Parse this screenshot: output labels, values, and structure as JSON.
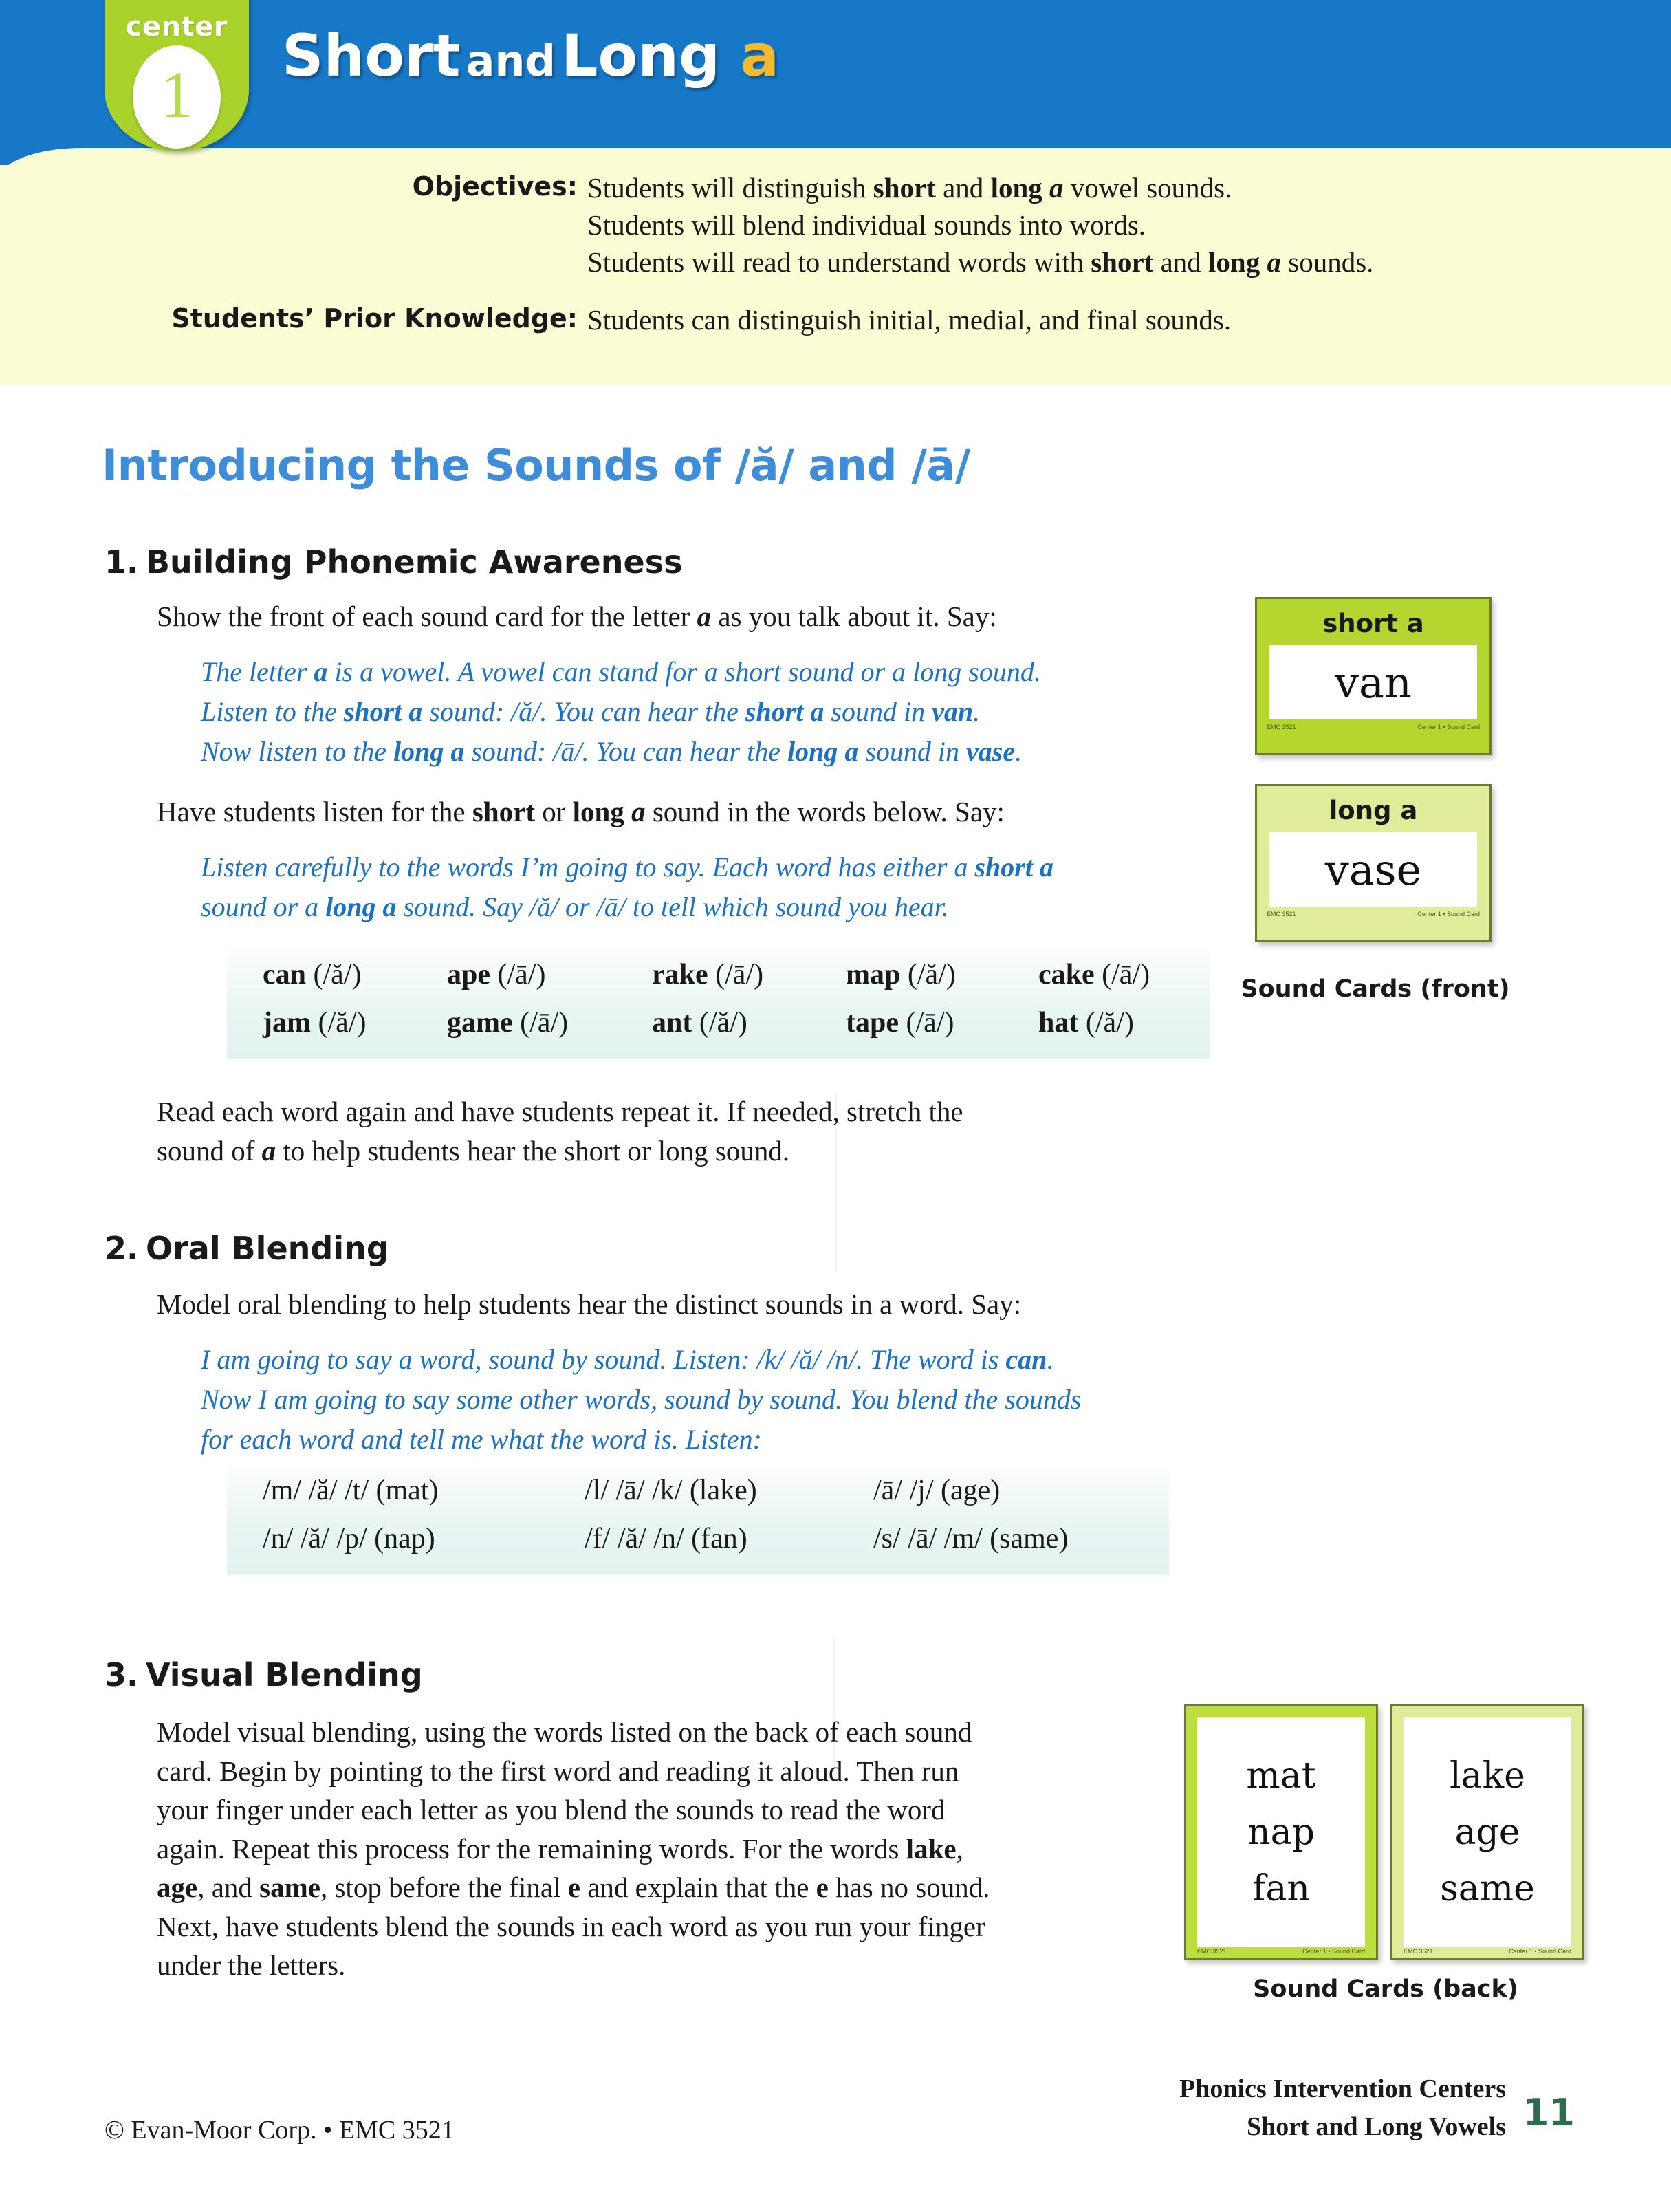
{
  "header": {
    "center_label": "center",
    "center_number": "1",
    "title_part1": "Short",
    "title_and": "and",
    "title_part2": "Long",
    "title_letter": "a",
    "colors": {
      "banner_blue": "#1878c8",
      "tab_green": "#a9d22a",
      "cream": "#fbfbd4",
      "title_accent": "#f7b92c"
    }
  },
  "objectives": {
    "label": "Objectives:",
    "prior_label": "Students’ Prior Knowledge:",
    "lines": [
      "Students will distinguish short and long a vowel sounds.",
      "Students will blend individual sounds into words.",
      "Students will read to understand words with short and long a sounds."
    ],
    "prior_text": "Students can distinguish initial, medial, and final sounds."
  },
  "main_heading": "Introducing the Sounds of /ă/ and /ā/",
  "sections": [
    {
      "number": "1.",
      "title": "Building Phonemic Awareness",
      "intro": "Show the front of each sound card for the letter a as you talk about it. Say:",
      "say_lines": [
        "The letter a is a vowel. A vowel can stand for a short sound or a long sound.",
        "Listen to the short a sound: /ă/. You can hear the short a sound in van.",
        "Now listen to the long a sound: /ā/. You can hear the long a sound in vase."
      ],
      "intro2": "Have students listen for the short or long a sound in the words below. Say:",
      "say_lines2": [
        "Listen carefully to the words I’m going to say. Each word has either a short a",
        "sound or a long a sound. Say /ă/ or /ā/ to tell which sound you hear."
      ],
      "word_rows": [
        [
          {
            "word": "can",
            "sound": "(/ă/)"
          },
          {
            "word": "ape",
            "sound": "(/ā/)"
          },
          {
            "word": "rake",
            "sound": "(/ā/)"
          },
          {
            "word": "map",
            "sound": "(/ă/)"
          },
          {
            "word": "cake",
            "sound": "(/ā/)"
          }
        ],
        [
          {
            "word": "jam",
            "sound": "(/ă/)"
          },
          {
            "word": "game",
            "sound": "(/ā/)"
          },
          {
            "word": "ant",
            "sound": "(/ă/)"
          },
          {
            "word": "tape",
            "sound": "(/ā/)"
          },
          {
            "word": "hat",
            "sound": "(/ă/)"
          }
        ]
      ],
      "outro": [
        "Read each word again and have students repeat it. If needed, stretch the",
        "sound of a to help students hear the short or long sound."
      ]
    },
    {
      "number": "2.",
      "title": "Oral Blending",
      "intro": "Model oral blending to help students hear the distinct sounds in a word. Say:",
      "say_lines": [
        "I am going to say a word, sound by sound. Listen: /k/ /ă/ /n/. The word is can.",
        "Now I am going to say some other words, sound by sound. You blend the sounds",
        "for each word and tell me what the word is. Listen:"
      ],
      "blend_rows": [
        [
          "/m/ /ă/ /t/ (mat)",
          "/l/ /ā/ /k/ (lake)",
          "/ā/ /j/ (age)"
        ],
        [
          "/n/ /ă/ /p/ (nap)",
          "/f/ /ă/ /n/ (fan)",
          "/s/ /ā/ /m/ (same)"
        ]
      ]
    },
    {
      "number": "3.",
      "title": "Visual Blending",
      "paragraph": [
        "Model visual blending, using the words listed on the back of each sound",
        "card. Begin by pointing to the first word and reading it aloud. Then run",
        "your finger under each letter as you blend the sounds to read the word",
        "again. Repeat this process for the remaining words. For the words lake,",
        "age, and same, stop before the final e and explain that the e has no sound.",
        "Next, have students blend the sounds in each word as you run your finger",
        "under the letters."
      ]
    }
  ],
  "sound_cards_front": {
    "caption": "Sound Cards (front)",
    "cards": [
      {
        "label": "short a",
        "word": "van",
        "micro_left": "EMC 3521",
        "micro_right": "Center 1 • Sound Card"
      },
      {
        "label": "long a",
        "word": "vase",
        "micro_left": "EMC 3521",
        "micro_right": "Center 1 • Sound Card"
      }
    ]
  },
  "sound_cards_back": {
    "caption": "Sound Cards (back)",
    "cards": [
      {
        "words": [
          "mat",
          "nap",
          "fan"
        ],
        "micro_left": "EMC 3521",
        "micro_right": "Center 1 • Sound Card"
      },
      {
        "words": [
          "lake",
          "age",
          "same"
        ],
        "micro_left": "EMC 3521",
        "micro_right": "Center 1 • Sound Card"
      }
    ]
  },
  "footer": {
    "left": "© Evan-Moor Corp. • EMC 3521",
    "right_line1": "Phonics Intervention Centers",
    "right_line2": "Short and Long Vowels",
    "page": "11"
  }
}
